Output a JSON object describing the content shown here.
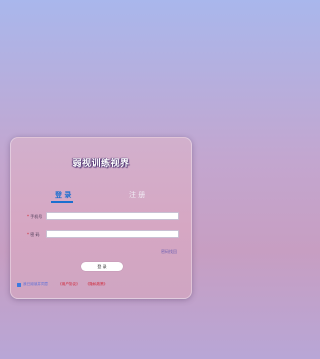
{
  "app": {
    "title": "弱视训练视界"
  },
  "tabs": {
    "login": "登 录",
    "register": "注 册"
  },
  "form": {
    "phone_required": "*",
    "phone_label": "手机号",
    "phone_value": "",
    "password_required": "*",
    "password_label": "密  码",
    "password_value": ""
  },
  "forgot_password": "密码找回",
  "login_button": "登 录",
  "agreement": {
    "checked": true,
    "text": "我已阅读并同意",
    "user_agreement": "《用户协议》",
    "privacy_policy": "《隐私政策》"
  },
  "colors": {
    "accent": "#1a6fd0",
    "link": "#d02030"
  }
}
